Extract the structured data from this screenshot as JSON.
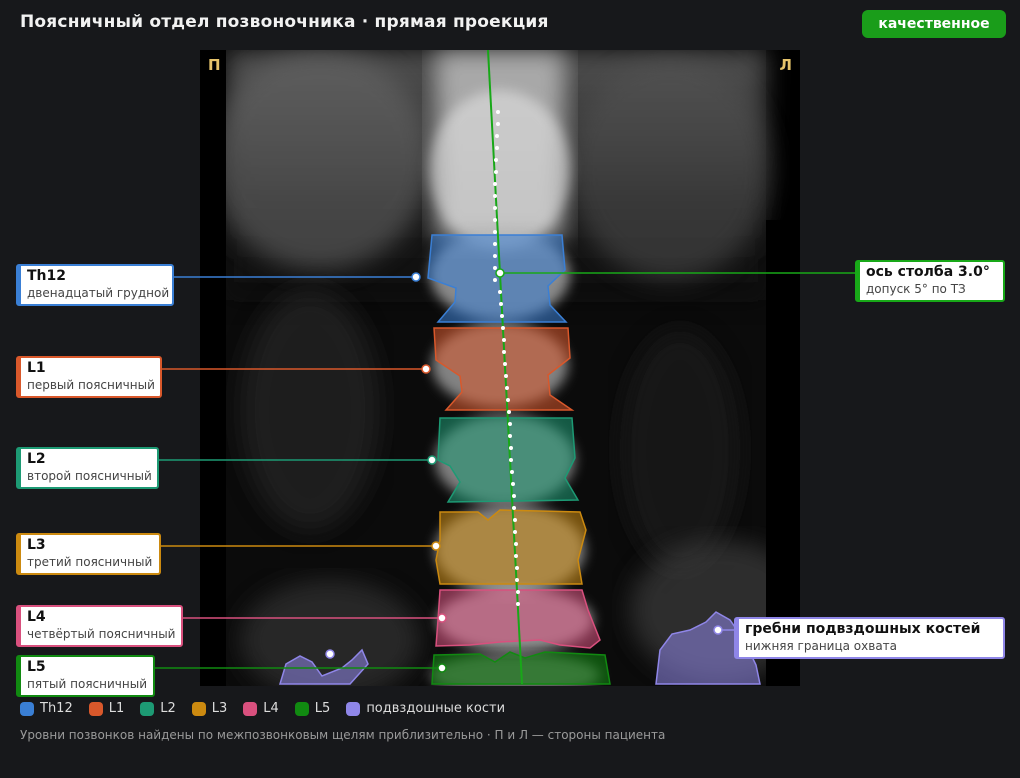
{
  "header": {
    "title": "Поясничный отдел позвоночника · прямая проекция",
    "status": "качественное",
    "status_color": "#1a9d1a"
  },
  "image": {
    "side_right": "П",
    "side_left": "Л"
  },
  "vertebrae": [
    {
      "id": "th12",
      "name": "Th12",
      "desc": "двенадцатый грудной",
      "color": "#3a7fd5"
    },
    {
      "id": "l1",
      "name": "L1",
      "desc": "первый поясничный",
      "color": "#d9582b"
    },
    {
      "id": "l2",
      "name": "L2",
      "desc": "второй поясничный",
      "color": "#1d9a74"
    },
    {
      "id": "l3",
      "name": "L3",
      "desc": "третий поясничный",
      "color": "#cc8a10"
    },
    {
      "id": "l4",
      "name": "L4",
      "desc": "четвёртый поясничный",
      "color": "#d9507e"
    },
    {
      "id": "l5",
      "name": "L5",
      "desc": "пятый поясничный",
      "color": "#118a11"
    }
  ],
  "axis": {
    "title": "ось столба 3.0°",
    "desc": "допуск 5° по ТЗ",
    "angle_deg": 3.0,
    "tolerance_deg": 5,
    "color": "#18a818"
  },
  "iliac": {
    "title": "гребни подвздошных костей",
    "desc": "нижняя граница охвата",
    "color": "#8f86e8"
  },
  "legend": [
    {
      "label": "Th12",
      "color": "#3a7fd5"
    },
    {
      "label": "L1",
      "color": "#d9582b"
    },
    {
      "label": "L2",
      "color": "#1d9a74"
    },
    {
      "label": "L3",
      "color": "#cc8a10"
    },
    {
      "label": "L4",
      "color": "#d9507e"
    },
    {
      "label": "L5",
      "color": "#118a11"
    },
    {
      "label": "подвздошные кости",
      "color": "#8f86e8"
    }
  ],
  "footnote": "Уровни позвонков найдены по межпозвонковым щелям приблизительно · П и Л — стороны пациента"
}
